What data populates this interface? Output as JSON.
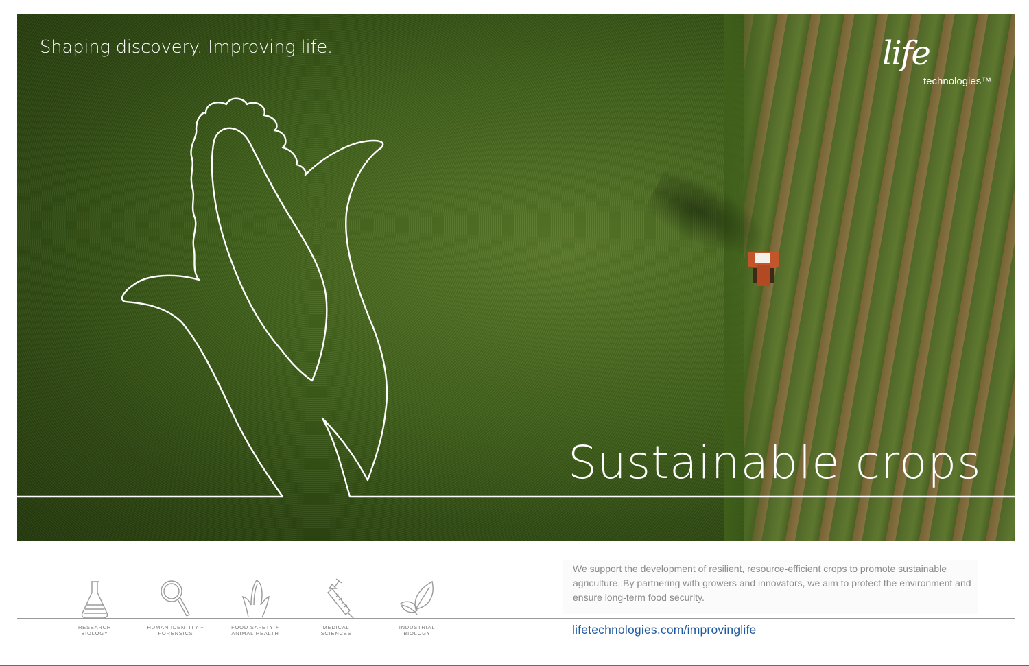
{
  "hero": {
    "tagline": "Shaping discovery. Improving life.",
    "headline": "Sustainable crops"
  },
  "logo": {
    "word": "life",
    "sub": "technologies™"
  },
  "categories": [
    {
      "line1": "RESEARCH",
      "line2": "BIOLOGY",
      "icon": "flask-icon"
    },
    {
      "line1": "HUMAN IDENTITY +",
      "line2": "FORENSICS",
      "icon": "magnifier-icon"
    },
    {
      "line1": "FOOD SAFETY +",
      "line2": "ANIMAL HEALTH",
      "icon": "corn-icon"
    },
    {
      "line1": "MEDICAL",
      "line2": "SCIENCES",
      "icon": "syringe-icon"
    },
    {
      "line1": "INDUSTRIAL",
      "line2": "BIOLOGY",
      "icon": "leaf-icon"
    }
  ],
  "body": {
    "text": "We support the development of resilient, resource-efficient crops to promote sustainable agriculture. By partnering with growers and innovators, we aim to protect the environment and ensure long-term food security."
  },
  "footer": {
    "url": "lifetechnologies.com/improvinglife"
  },
  "colors": {
    "link": "#1f5aa0",
    "field": "#3f5f1a"
  }
}
